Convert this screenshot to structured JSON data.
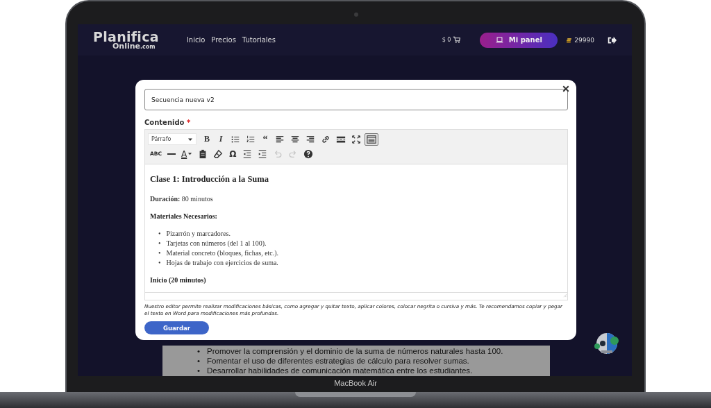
{
  "device": {
    "label": "MacBook Air"
  },
  "nav": {
    "logo": {
      "main": "Planifica",
      "sub": "Online",
      "suffix": ".com"
    },
    "links": [
      "Inicio",
      "Precios",
      "Tutoriales"
    ],
    "cart": "$ 0",
    "panel_button": "Mi panel",
    "coins": "29990"
  },
  "background_marker": "•",
  "background_list": [
    "Promover la comprensión y el dominio de la suma de números naturales hasta 100.",
    "Fomentar el uso de diferentes estrategias de cálculo para resolver sumas.",
    "Desarrollar habilidades de comunicación matemática entre los estudiantes."
  ],
  "modal": {
    "title_value": "Secuencia nueva v2",
    "content_label": "Contenido",
    "required_mark": "*",
    "editor": {
      "format": "Párrafo",
      "toolbar_rows": [
        [
          {
            "kind": "bold",
            "glyph": "B",
            "pressed": false,
            "disabled": false
          },
          {
            "kind": "italic",
            "glyph": "I",
            "pressed": false,
            "disabled": false
          },
          {
            "kind": "bullets",
            "pressed": false,
            "disabled": false
          },
          {
            "kind": "numbers",
            "pressed": false,
            "disabled": false
          },
          {
            "kind": "quote",
            "glyph": "“",
            "pressed": false,
            "disabled": false
          },
          {
            "kind": "align-left",
            "pressed": false,
            "disabled": false
          },
          {
            "kind": "align-center",
            "pressed": false,
            "disabled": false
          },
          {
            "kind": "align-right",
            "pressed": false,
            "disabled": false
          },
          {
            "kind": "link",
            "pressed": false,
            "disabled": false
          },
          {
            "kind": "more",
            "pressed": false,
            "disabled": false
          },
          {
            "kind": "fullscreen",
            "pressed": false,
            "disabled": false
          },
          {
            "kind": "toolbar",
            "pressed": true,
            "disabled": false
          }
        ],
        [
          {
            "kind": "strike",
            "glyph": "ABC",
            "pressed": false,
            "disabled": false
          },
          {
            "kind": "hr",
            "pressed": false,
            "disabled": false
          },
          {
            "kind": "textcolor",
            "glyph": "A",
            "pressed": false,
            "disabled": false
          },
          {
            "kind": "paste",
            "pressed": false,
            "disabled": false
          },
          {
            "kind": "eraser",
            "pressed": false,
            "disabled": false
          },
          {
            "kind": "symbol",
            "glyph": "Ω",
            "pressed": false,
            "disabled": false
          },
          {
            "kind": "outdent",
            "pressed": false,
            "disabled": false
          },
          {
            "kind": "indent",
            "pressed": false,
            "disabled": false
          },
          {
            "kind": "undo",
            "pressed": false,
            "disabled": true
          },
          {
            "kind": "redo",
            "pressed": false,
            "disabled": true
          },
          {
            "kind": "help",
            "pressed": false,
            "disabled": false
          }
        ]
      ],
      "content": [
        {
          "kind": "heading",
          "text": "Clase 1: Introducción a la Suma"
        },
        {
          "kind": "paragraph",
          "text": "**Duración:** 80 minutos"
        },
        {
          "kind": "subheading",
          "text": "Materiales Necesarios:"
        },
        {
          "kind": "list",
          "marker": "•",
          "items": [
            "Pizarrón y marcadores.",
            "Tarjetas con números (del 1 al 100).",
            "Material concreto (bloques, fichas, etc.).",
            "Hojas de trabajo con ejercicios de suma."
          ]
        },
        {
          "kind": "subheading",
          "text": "Inicio (20 minutos)"
        }
      ]
    },
    "hint": "Nuestro editor permite realizar modificaciones básicas, como agregar y quitar texto, aplicar colores, colocar negrita o cursiva y más. Te recomendamos copiar y pegar el texto en Word para modificaciones más profundas.",
    "save_button": "Guardar"
  }
}
